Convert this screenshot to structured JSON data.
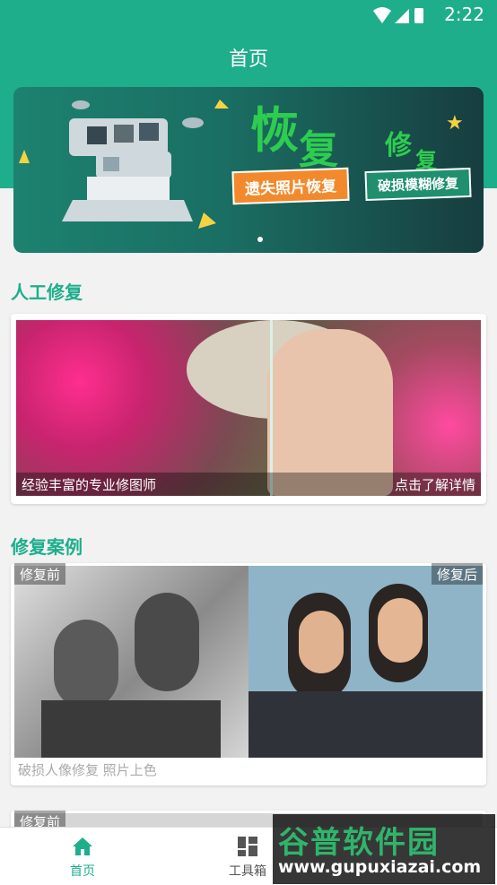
{
  "status": {
    "time": "2:22"
  },
  "header": {
    "title": "首页"
  },
  "banner": {
    "title_big_1": "恢",
    "title_big_2": "复",
    "title_small_1": "修",
    "title_small_2": "复",
    "tag_1": "遗失照片恢复",
    "tag_2": "破损模糊修复"
  },
  "manual": {
    "section_title": "人工修复",
    "caption_left": "经验丰富的专业修图师",
    "caption_right": "点击了解详情"
  },
  "cases": {
    "section_title": "修复案例",
    "before_label": "修复前",
    "after_label": "修复后",
    "caption": "破损人像修复 照片上色",
    "next_before_label": "修复前"
  },
  "tabbar": {
    "items": [
      {
        "label": "首页",
        "icon": "home-icon",
        "active": true
      },
      {
        "label": "工具箱",
        "icon": "grid-icon",
        "active": false
      }
    ]
  },
  "watermark": {
    "brand": "谷普软件园",
    "url": "www.gupuxiazai.com"
  },
  "colors": {
    "accent": "#1fae8c"
  }
}
